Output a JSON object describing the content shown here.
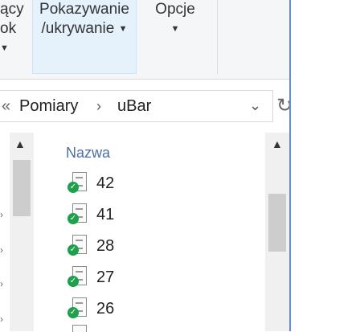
{
  "ribbon": {
    "btn1": {
      "line1": "ący",
      "line2": "ok"
    },
    "btn2": {
      "line1": "Pokazywanie",
      "line2": "/ukrywanie"
    },
    "btn3": {
      "line1": "Opcje"
    }
  },
  "address": {
    "leading": "«",
    "crumbs": [
      "Pomiary",
      "uBar"
    ],
    "separator": "›"
  },
  "list": {
    "header": "Nazwa",
    "files": [
      "42",
      "41",
      "28",
      "27",
      "26"
    ]
  },
  "colors": {
    "ribbon_active": "#e5f1fb",
    "header_text": "#4c6ea8",
    "sync_ok": "#1ea14a",
    "window_edge": "#6a8fc8"
  }
}
